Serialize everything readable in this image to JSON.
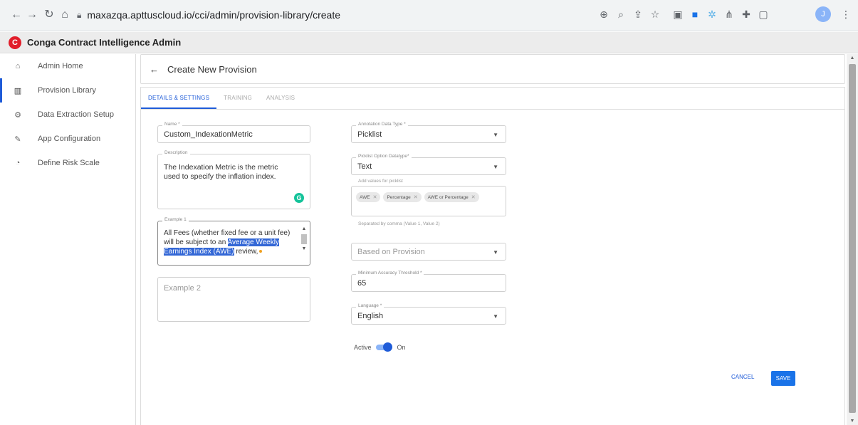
{
  "browser": {
    "url": "maxazqa.apttuscloud.io/cci/admin/provision-library/create",
    "profile_initial": "J"
  },
  "app": {
    "logo_letter": "C",
    "title": "Conga Contract Intelligence Admin"
  },
  "sidebar": {
    "items": [
      {
        "label": "Admin Home",
        "icon": "home-icon"
      },
      {
        "label": "Provision Library",
        "icon": "library-icon",
        "active": true
      },
      {
        "label": "Data Extraction Setup",
        "icon": "gear-icon"
      },
      {
        "label": "App Configuration",
        "icon": "wrench-icon"
      },
      {
        "label": "Define Risk Scale",
        "icon": "gauge-icon"
      }
    ]
  },
  "page": {
    "title": "Create New Provision",
    "tabs": [
      "DETAILS & SETTINGS",
      "TRAINING",
      "ANALYSIS"
    ],
    "active_tab": 0
  },
  "form": {
    "name": {
      "label": "Name *",
      "value": "Custom_IndexationMetric"
    },
    "description": {
      "label": "Description",
      "value": "The Indexation Metric is the metric used to specify the inflation index."
    },
    "example1": {
      "label": "Example 1",
      "before": "All Fees (whether fixed fee or a unit fee) will be subject to an ",
      "highlight": "Average Weekly Earnings Index (AWE)",
      "after": " review,"
    },
    "example2": {
      "placeholder": "Example 2"
    },
    "annotation_type": {
      "label": "Annotation Data Type *",
      "value": "Picklist"
    },
    "picklist_datatype": {
      "label": "Picklist Option Datatype*",
      "value": "Text"
    },
    "picklist_values": {
      "label": "Add values for picklist",
      "chips": [
        "AWE",
        "Percentage",
        "AWE or Percentage"
      ],
      "hint": "Separated by comma (Value 1, Value 2)"
    },
    "based_on": {
      "placeholder": "Based on Provision"
    },
    "accuracy": {
      "label": "Minimum Accuracy Threshold *",
      "value": "65"
    },
    "language": {
      "label": "Language *",
      "value": "English"
    },
    "active": {
      "label": "Active",
      "state": "On"
    }
  },
  "actions": {
    "cancel": "CANCEL",
    "save": "SAVE"
  },
  "colors": {
    "accent": "#1e5bd8",
    "brand": "#e11d2a",
    "save": "#1a73e8"
  }
}
